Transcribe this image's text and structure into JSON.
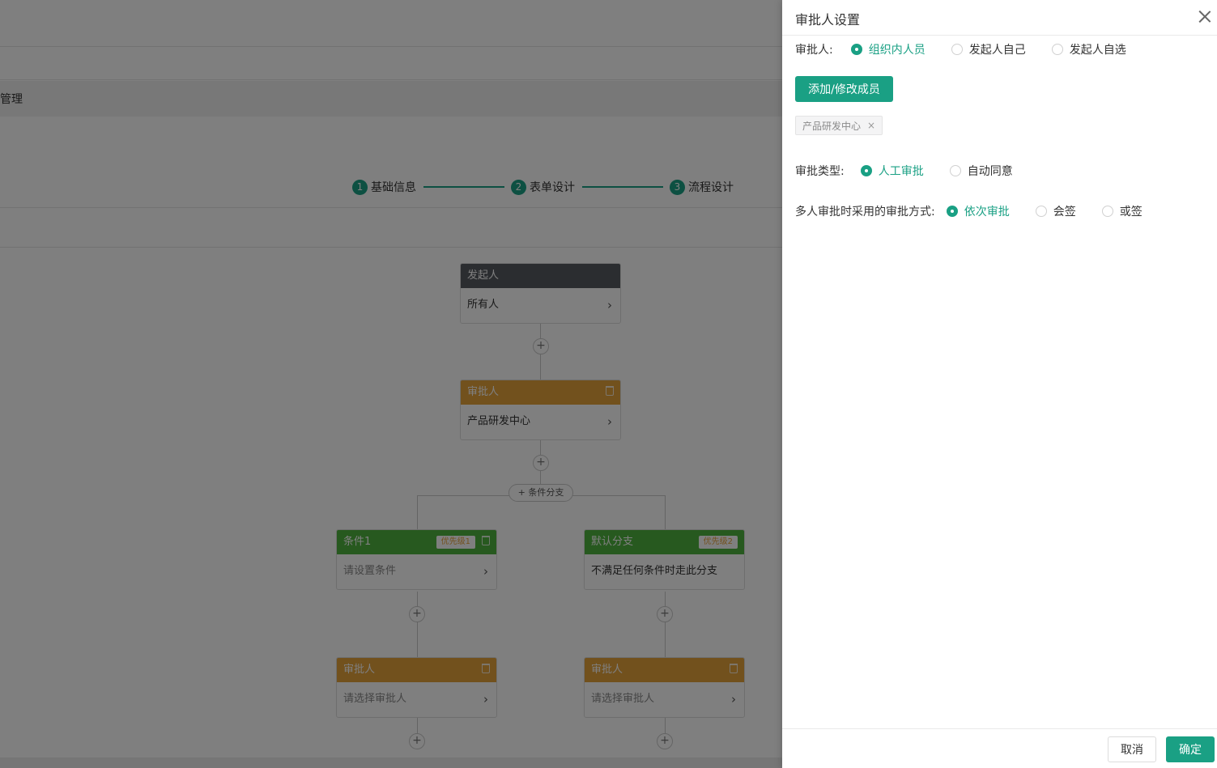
{
  "background": {
    "breadcrumb_fragment": "管理",
    "steps": [
      {
        "num": "1",
        "label": "基础信息"
      },
      {
        "num": "2",
        "label": "表单设计"
      },
      {
        "num": "3",
        "label": "流程设计"
      }
    ],
    "flow": {
      "initiator": {
        "title": "发起人",
        "body": "所有人"
      },
      "approver": {
        "title": "审批人",
        "body": "产品研发中心"
      },
      "add_condition_label": "+ 条件分支",
      "branches": [
        {
          "title": "条件1",
          "priority": "优先级1",
          "body": "请设置条件",
          "approver_title": "审批人",
          "approver_body": "请选择审批人"
        },
        {
          "title": "默认分支",
          "priority": "优先级2",
          "body": "不满足任何条件时走此分支",
          "approver_title": "审批人",
          "approver_body": "请选择审批人"
        }
      ],
      "plus_symbol": "+",
      "chevron": "›"
    }
  },
  "drawer": {
    "title": "审批人设置",
    "approver": {
      "label": "审批人:",
      "options": [
        "组织内人员",
        "发起人自己",
        "发起人自选"
      ],
      "selected": "组织内人员"
    },
    "add_member_button": "添加/修改成员",
    "selected_tags": [
      {
        "label": "产品研发中心",
        "close": "×"
      }
    ],
    "approval_type": {
      "label": "审批类型:",
      "options": [
        "人工审批",
        "自动同意"
      ],
      "selected": "人工审批"
    },
    "multi_mode": {
      "label": "多人审批时采用的审批方式:",
      "options": [
        "依次审批",
        "会签",
        "或签"
      ],
      "selected": "依次审批"
    },
    "footer": {
      "cancel": "取消",
      "confirm": "确定"
    }
  },
  "colors": {
    "accent": "#1aa084",
    "initiator_header": "#575a60",
    "approver_header": "#e4a23b",
    "condition_header": "#4fb23e"
  }
}
